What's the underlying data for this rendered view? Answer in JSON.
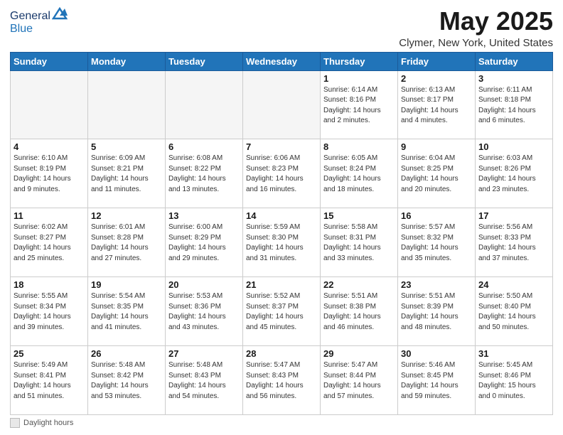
{
  "header": {
    "logo_general": "General",
    "logo_blue": "Blue",
    "month_title": "May 2025",
    "location": "Clymer, New York, United States"
  },
  "footer": {
    "daylight_label": "Daylight hours"
  },
  "columns": [
    "Sunday",
    "Monday",
    "Tuesday",
    "Wednesday",
    "Thursday",
    "Friday",
    "Saturday"
  ],
  "weeks": [
    [
      {
        "day": "",
        "info": ""
      },
      {
        "day": "",
        "info": ""
      },
      {
        "day": "",
        "info": ""
      },
      {
        "day": "",
        "info": ""
      },
      {
        "day": "1",
        "info": "Sunrise: 6:14 AM\nSunset: 8:16 PM\nDaylight: 14 hours\nand 2 minutes."
      },
      {
        "day": "2",
        "info": "Sunrise: 6:13 AM\nSunset: 8:17 PM\nDaylight: 14 hours\nand 4 minutes."
      },
      {
        "day": "3",
        "info": "Sunrise: 6:11 AM\nSunset: 8:18 PM\nDaylight: 14 hours\nand 6 minutes."
      }
    ],
    [
      {
        "day": "4",
        "info": "Sunrise: 6:10 AM\nSunset: 8:19 PM\nDaylight: 14 hours\nand 9 minutes."
      },
      {
        "day": "5",
        "info": "Sunrise: 6:09 AM\nSunset: 8:21 PM\nDaylight: 14 hours\nand 11 minutes."
      },
      {
        "day": "6",
        "info": "Sunrise: 6:08 AM\nSunset: 8:22 PM\nDaylight: 14 hours\nand 13 minutes."
      },
      {
        "day": "7",
        "info": "Sunrise: 6:06 AM\nSunset: 8:23 PM\nDaylight: 14 hours\nand 16 minutes."
      },
      {
        "day": "8",
        "info": "Sunrise: 6:05 AM\nSunset: 8:24 PM\nDaylight: 14 hours\nand 18 minutes."
      },
      {
        "day": "9",
        "info": "Sunrise: 6:04 AM\nSunset: 8:25 PM\nDaylight: 14 hours\nand 20 minutes."
      },
      {
        "day": "10",
        "info": "Sunrise: 6:03 AM\nSunset: 8:26 PM\nDaylight: 14 hours\nand 23 minutes."
      }
    ],
    [
      {
        "day": "11",
        "info": "Sunrise: 6:02 AM\nSunset: 8:27 PM\nDaylight: 14 hours\nand 25 minutes."
      },
      {
        "day": "12",
        "info": "Sunrise: 6:01 AM\nSunset: 8:28 PM\nDaylight: 14 hours\nand 27 minutes."
      },
      {
        "day": "13",
        "info": "Sunrise: 6:00 AM\nSunset: 8:29 PM\nDaylight: 14 hours\nand 29 minutes."
      },
      {
        "day": "14",
        "info": "Sunrise: 5:59 AM\nSunset: 8:30 PM\nDaylight: 14 hours\nand 31 minutes."
      },
      {
        "day": "15",
        "info": "Sunrise: 5:58 AM\nSunset: 8:31 PM\nDaylight: 14 hours\nand 33 minutes."
      },
      {
        "day": "16",
        "info": "Sunrise: 5:57 AM\nSunset: 8:32 PM\nDaylight: 14 hours\nand 35 minutes."
      },
      {
        "day": "17",
        "info": "Sunrise: 5:56 AM\nSunset: 8:33 PM\nDaylight: 14 hours\nand 37 minutes."
      }
    ],
    [
      {
        "day": "18",
        "info": "Sunrise: 5:55 AM\nSunset: 8:34 PM\nDaylight: 14 hours\nand 39 minutes."
      },
      {
        "day": "19",
        "info": "Sunrise: 5:54 AM\nSunset: 8:35 PM\nDaylight: 14 hours\nand 41 minutes."
      },
      {
        "day": "20",
        "info": "Sunrise: 5:53 AM\nSunset: 8:36 PM\nDaylight: 14 hours\nand 43 minutes."
      },
      {
        "day": "21",
        "info": "Sunrise: 5:52 AM\nSunset: 8:37 PM\nDaylight: 14 hours\nand 45 minutes."
      },
      {
        "day": "22",
        "info": "Sunrise: 5:51 AM\nSunset: 8:38 PM\nDaylight: 14 hours\nand 46 minutes."
      },
      {
        "day": "23",
        "info": "Sunrise: 5:51 AM\nSunset: 8:39 PM\nDaylight: 14 hours\nand 48 minutes."
      },
      {
        "day": "24",
        "info": "Sunrise: 5:50 AM\nSunset: 8:40 PM\nDaylight: 14 hours\nand 50 minutes."
      }
    ],
    [
      {
        "day": "25",
        "info": "Sunrise: 5:49 AM\nSunset: 8:41 PM\nDaylight: 14 hours\nand 51 minutes."
      },
      {
        "day": "26",
        "info": "Sunrise: 5:48 AM\nSunset: 8:42 PM\nDaylight: 14 hours\nand 53 minutes."
      },
      {
        "day": "27",
        "info": "Sunrise: 5:48 AM\nSunset: 8:43 PM\nDaylight: 14 hours\nand 54 minutes."
      },
      {
        "day": "28",
        "info": "Sunrise: 5:47 AM\nSunset: 8:43 PM\nDaylight: 14 hours\nand 56 minutes."
      },
      {
        "day": "29",
        "info": "Sunrise: 5:47 AM\nSunset: 8:44 PM\nDaylight: 14 hours\nand 57 minutes."
      },
      {
        "day": "30",
        "info": "Sunrise: 5:46 AM\nSunset: 8:45 PM\nDaylight: 14 hours\nand 59 minutes."
      },
      {
        "day": "31",
        "info": "Sunrise: 5:45 AM\nSunset: 8:46 PM\nDaylight: 15 hours\nand 0 minutes."
      }
    ]
  ]
}
